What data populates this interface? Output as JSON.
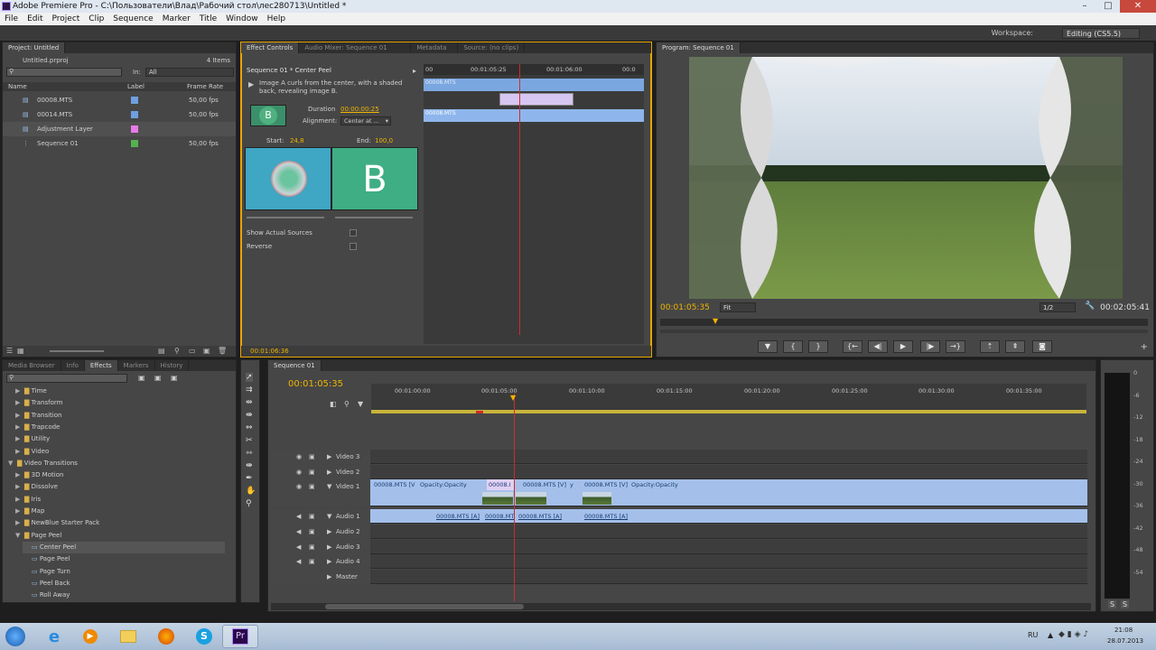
{
  "window": {
    "title": "Adobe Premiere Pro - C:\\Пользователи\\Влад\\Рабочий стол\\лес280713\\Untitled *"
  },
  "menu": [
    "File",
    "Edit",
    "Project",
    "Clip",
    "Sequence",
    "Marker",
    "Title",
    "Window",
    "Help"
  ],
  "workspace": {
    "label": "Workspace:",
    "value": "Editing (CS5.5)"
  },
  "project": {
    "tab": "Project: Untitled",
    "file": "Untitled.prproj",
    "items_count": "4 Items",
    "in_label": "In:",
    "in_value": "All",
    "columns": {
      "name": "Name",
      "label": "Label",
      "frame_rate": "Frame Rate"
    },
    "items": [
      {
        "name": "00008.MTS",
        "color": "#6f9fe0",
        "rate": "50,00 fps"
      },
      {
        "name": "00014.MTS",
        "color": "#6f9fe0",
        "rate": "50,00 fps"
      },
      {
        "name": "Adjustment Layer",
        "color": "#e87ae8",
        "rate": ""
      },
      {
        "name": "Sequence 01",
        "color": "#55b050",
        "rate": "50,00 fps"
      }
    ]
  },
  "effect_controls": {
    "tabs": [
      "Effect Controls",
      "Audio Mixer: Sequence 01",
      "Metadata",
      "Source: (no clips)"
    ],
    "header": "Sequence 01 * Center Peel",
    "description": "Image A curls from the center, with a shaded back, revealing image B.",
    "duration_label": "Duration",
    "duration_value": "00:00:00:25",
    "alignment_label": "Alignment:",
    "alignment_value": "Center at ...",
    "start_label": "Start:",
    "start_value": "24,8",
    "end_label": "End:",
    "end_value": "100,0",
    "thumb_letter": "B",
    "show_actual_sources": "Show Actual Sources",
    "reverse": "Reverse",
    "ruler": [
      "00",
      "00:01:05:25",
      "00:01:06:00",
      "00:0"
    ],
    "clip_a": "00008.MTS",
    "clip_b": "00008.MTS",
    "timecode": "00:01:06:36"
  },
  "program": {
    "tab": "Program: Sequence 01",
    "timecode": "00:01:05:35",
    "fit": "Fit",
    "quality": "1/2",
    "duration": "00:02:05:41"
  },
  "effects": {
    "tabs": [
      "Media Browser",
      "Info",
      "Effects",
      "Markers",
      "History"
    ],
    "tree": [
      {
        "label": "Time",
        "level": 1,
        "type": "folder"
      },
      {
        "label": "Transform",
        "level": 1,
        "type": "folder"
      },
      {
        "label": "Transition",
        "level": 1,
        "type": "folder"
      },
      {
        "label": "Trapcode",
        "level": 1,
        "type": "folder"
      },
      {
        "label": "Utility",
        "level": 1,
        "type": "folder"
      },
      {
        "label": "Video",
        "level": 1,
        "type": "folder"
      },
      {
        "label": "Video Transitions",
        "level": 0,
        "type": "open"
      },
      {
        "label": "3D Motion",
        "level": 1,
        "type": "folder"
      },
      {
        "label": "Dissolve",
        "level": 1,
        "type": "folder"
      },
      {
        "label": "Iris",
        "level": 1,
        "type": "folder"
      },
      {
        "label": "Map",
        "level": 1,
        "type": "folder"
      },
      {
        "label": "NewBlue Starter Pack",
        "level": 1,
        "type": "folder"
      },
      {
        "label": "Page Peel",
        "level": 1,
        "type": "open"
      },
      {
        "label": "Center Peel",
        "level": 2,
        "type": "item"
      },
      {
        "label": "Page Peel",
        "level": 2,
        "type": "item"
      },
      {
        "label": "Page Turn",
        "level": 2,
        "type": "item"
      },
      {
        "label": "Peel Back",
        "level": 2,
        "type": "item"
      },
      {
        "label": "Roll Away",
        "level": 2,
        "type": "item"
      }
    ]
  },
  "timeline": {
    "tab": "Sequence 01",
    "timecode": "00:01:05:35",
    "ruler": [
      "00:01:00:00",
      "00:01:05:00",
      "00:01:10:00",
      "00:01:15:00",
      "00:01:20:00",
      "00:01:25:00",
      "00:01:30:00",
      "00:01:35:00"
    ],
    "tracks": [
      "Video 3",
      "Video 2",
      "Video 1",
      "Audio 1",
      "Audio 2",
      "Audio 3",
      "Audio 4",
      "Master"
    ],
    "v1_clips": [
      "00008.MTS [V]",
      "Opacity:Opacity",
      "00008.I",
      "00008.MTS [V]",
      "y",
      "00008.MTS [V]",
      "Opacity:Opacity"
    ],
    "a1_clips": [
      "00008.MTS [A]",
      "00008.MTS",
      "00008.MTS [A]",
      "00008.MTS [A]"
    ]
  },
  "meter": {
    "scale": [
      "0",
      "-6",
      "-12",
      "-18",
      "-24",
      "-30",
      "-36",
      "-42",
      "-48",
      "-54"
    ],
    "s": "S"
  },
  "tray": {
    "lang": "RU",
    "time": "21:08",
    "date": "28.07.2013"
  }
}
